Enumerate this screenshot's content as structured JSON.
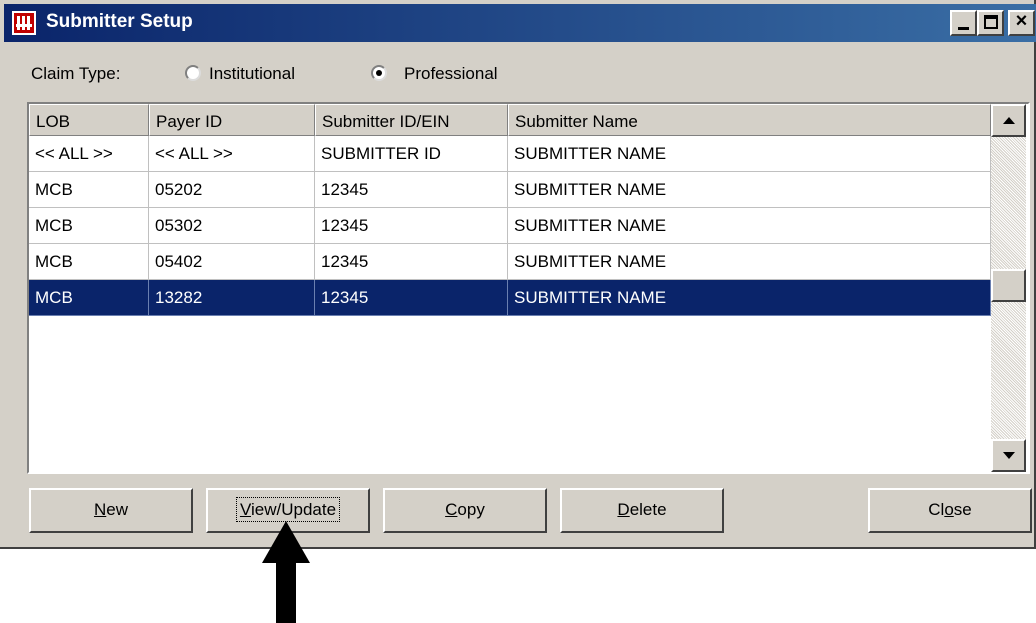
{
  "window": {
    "title": "Submitter Setup"
  },
  "claim_type": {
    "label": "Claim Type:",
    "options": [
      {
        "label": "Institutional",
        "selected": false
      },
      {
        "label": "Professional",
        "selected": true
      }
    ]
  },
  "table": {
    "columns": [
      "LOB",
      "Payer ID",
      "Submitter ID/EIN",
      "Submitter Name"
    ],
    "rows": [
      [
        "<< ALL >>",
        "<< ALL >>",
        "SUBMITTER ID",
        "SUBMITTER NAME"
      ],
      [
        "MCB",
        "05202",
        "12345",
        "SUBMITTER NAME"
      ],
      [
        "MCB",
        "05302",
        "12345",
        "SUBMITTER NAME"
      ],
      [
        "MCB",
        "05402",
        "12345",
        "SUBMITTER NAME"
      ],
      [
        "MCB",
        "13282",
        "12345",
        "SUBMITTER NAME"
      ]
    ],
    "selected_row": 4
  },
  "buttons": {
    "new": {
      "mnemonic": "N",
      "rest": "ew"
    },
    "view_update": {
      "mnemonic": "V",
      "rest": "iew/Update"
    },
    "copy": {
      "mnemonic": "C",
      "rest": "opy"
    },
    "delete": {
      "mnemonic": "D",
      "rest": "elete"
    },
    "close": {
      "pre": "Cl",
      "mnemonic": "o",
      "rest": "se"
    }
  },
  "icons": {
    "app": "app-table-icon",
    "minimize": "minimize-icon",
    "maximize": "maximize-icon",
    "close": "close-icon",
    "scroll_up": "scroll-up-icon",
    "scroll_down": "scroll-down-icon",
    "pointer": "up-arrow-icon"
  },
  "colors": {
    "titlebar": "#0a246a",
    "selection": "#0a246a",
    "dialog": "#d4d0c8"
  }
}
